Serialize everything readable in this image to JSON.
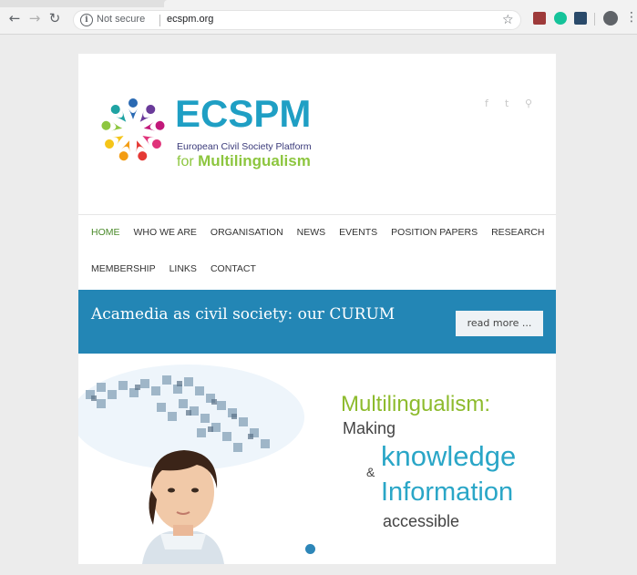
{
  "browser": {
    "back_icon": "arrow-left-icon",
    "forward_icon": "arrow-right-icon",
    "reload_icon": "reload-icon",
    "security_label": "Not secure",
    "url": "ecspm.org",
    "bookmark_icon": "star-icon",
    "extensions": [
      "pdf-extension-icon",
      "grammarly-icon",
      "note-extension-icon"
    ],
    "profile_icon": "profile-icon",
    "menu_icon": "kebab-menu-icon"
  },
  "site": {
    "logo": {
      "title": "ECSPM",
      "subtitle_line1": "European Civil Society Platform",
      "subtitle_for": "for",
      "subtitle_line2": "Multilingualism",
      "colors": {
        "title": "#1f9fc4",
        "green": "#8dc63f",
        "navy": "#3a3a7a"
      }
    },
    "social": [
      "facebook-icon",
      "twitter-icon",
      "search-icon"
    ],
    "nav_row1": [
      {
        "label": "HOME",
        "active": true
      },
      {
        "label": "WHO WE ARE"
      },
      {
        "label": "ORGANISATION"
      },
      {
        "label": "NEWS"
      },
      {
        "label": "EVENTS"
      },
      {
        "label": "POSITION PAPERS"
      },
      {
        "label": "RESEARCH"
      }
    ],
    "nav_row2": [
      {
        "label": "MEMBERSHIP"
      },
      {
        "label": "LINKS"
      },
      {
        "label": "CONTACT"
      }
    ],
    "banner": {
      "title": "Acamedia as civil society: our CURUM",
      "button": "read more ...",
      "color": "#2386b5"
    },
    "hero": {
      "line1": "Multilingualism:",
      "line2": "Making",
      "amp": "&",
      "line3": "knowledge",
      "line4": "Information",
      "line5": "accessible",
      "slide_dots": 1
    }
  }
}
